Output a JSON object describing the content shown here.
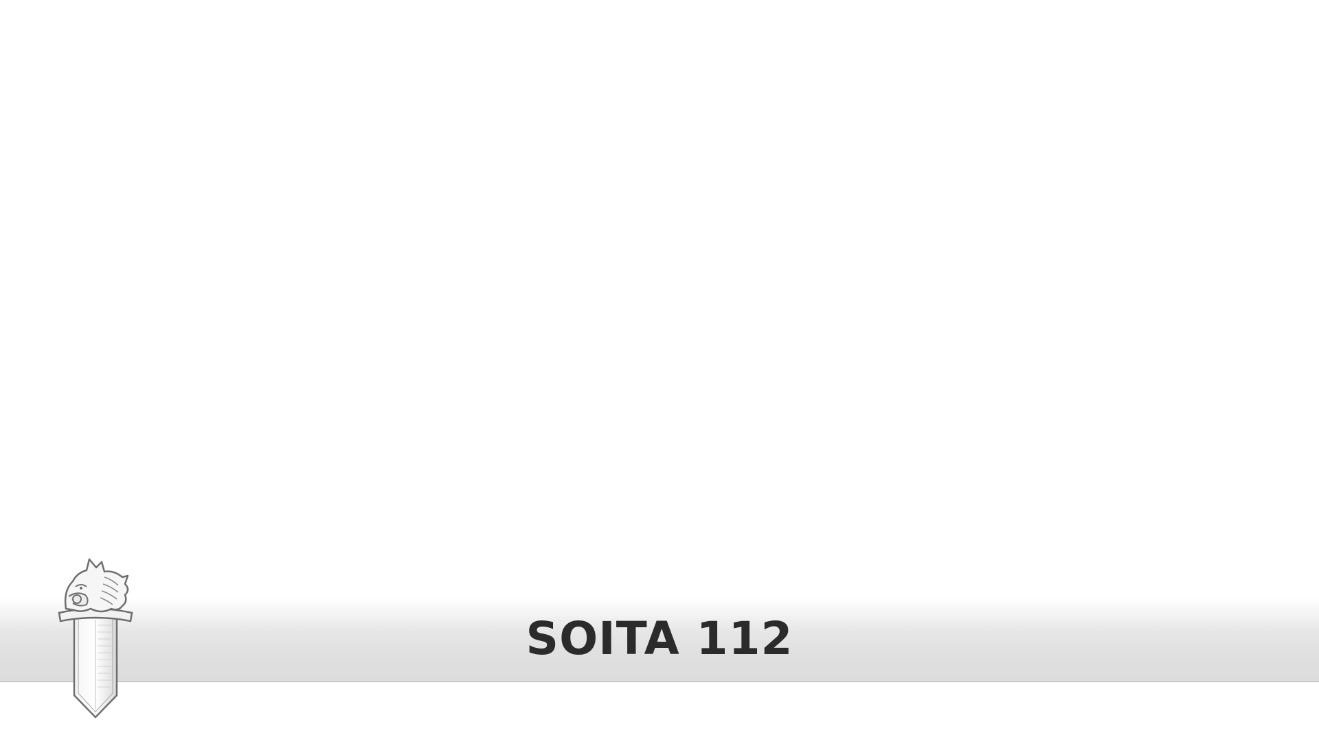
{
  "banner": {
    "text": "SOITA 112",
    "background_color": "#e2e2e2",
    "text_color": "#2b2b2b"
  },
  "emblem": {
    "icon": "police-emblem-icon"
  }
}
